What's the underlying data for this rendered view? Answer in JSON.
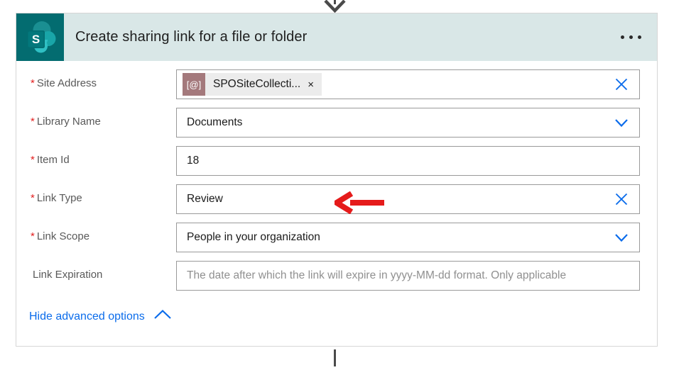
{
  "connectors": {
    "top_arrow_icon": "arrow-down-icon",
    "bottom_line_icon": "connector-line-icon",
    "color": "#4a4a4a"
  },
  "card": {
    "header": {
      "app_icon": "sharepoint-icon",
      "title": "Create sharing link for a file or folder",
      "overflow_label": "...",
      "background": "#d9e7e7",
      "icon_background": "#036c70"
    },
    "fields": [
      {
        "label": "Site Address",
        "required": true,
        "required_marker": "*",
        "type": "token",
        "token": {
          "icon_glyph": "[@]",
          "icon_name": "dynamic-content-icon",
          "text": "SPOSiteCollecti...",
          "close_glyph": "×"
        },
        "affordance": "clear-icon"
      },
      {
        "label": "Library Name",
        "required": true,
        "required_marker": "*",
        "type": "dropdown",
        "value": "Documents",
        "affordance": "chevron-down-icon"
      },
      {
        "label": "Item Id",
        "required": true,
        "required_marker": "*",
        "type": "text",
        "value": "18",
        "affordance": "none"
      },
      {
        "label": "Link Type",
        "required": true,
        "required_marker": "*",
        "type": "text",
        "value": "Review",
        "affordance": "clear-icon"
      },
      {
        "label": "Link Scope",
        "required": true,
        "required_marker": "*",
        "type": "dropdown",
        "value": "People in your organization",
        "affordance": "chevron-down-icon"
      },
      {
        "label": "Link Expiration",
        "required": false,
        "required_marker": "",
        "type": "text",
        "value": "",
        "placeholder": "The date after which the link will expire in yyyy-MM-dd format. Only applicable",
        "affordance": "none"
      }
    ],
    "advanced_options": {
      "label": "Hide advanced options",
      "icon": "chevron-up-icon",
      "color": "#0b6ceb"
    }
  },
  "annotation": {
    "type": "arrow-left",
    "color": "#e51b1b",
    "target": "Link Type"
  },
  "colors": {
    "accent_blue": "#0b6ceb",
    "required_red": "#e32020",
    "annotation_red": "#e51b1b",
    "sharepoint_teal": "#036c70",
    "header_band": "#d9e7e7",
    "token_icon": "#a4797c"
  }
}
